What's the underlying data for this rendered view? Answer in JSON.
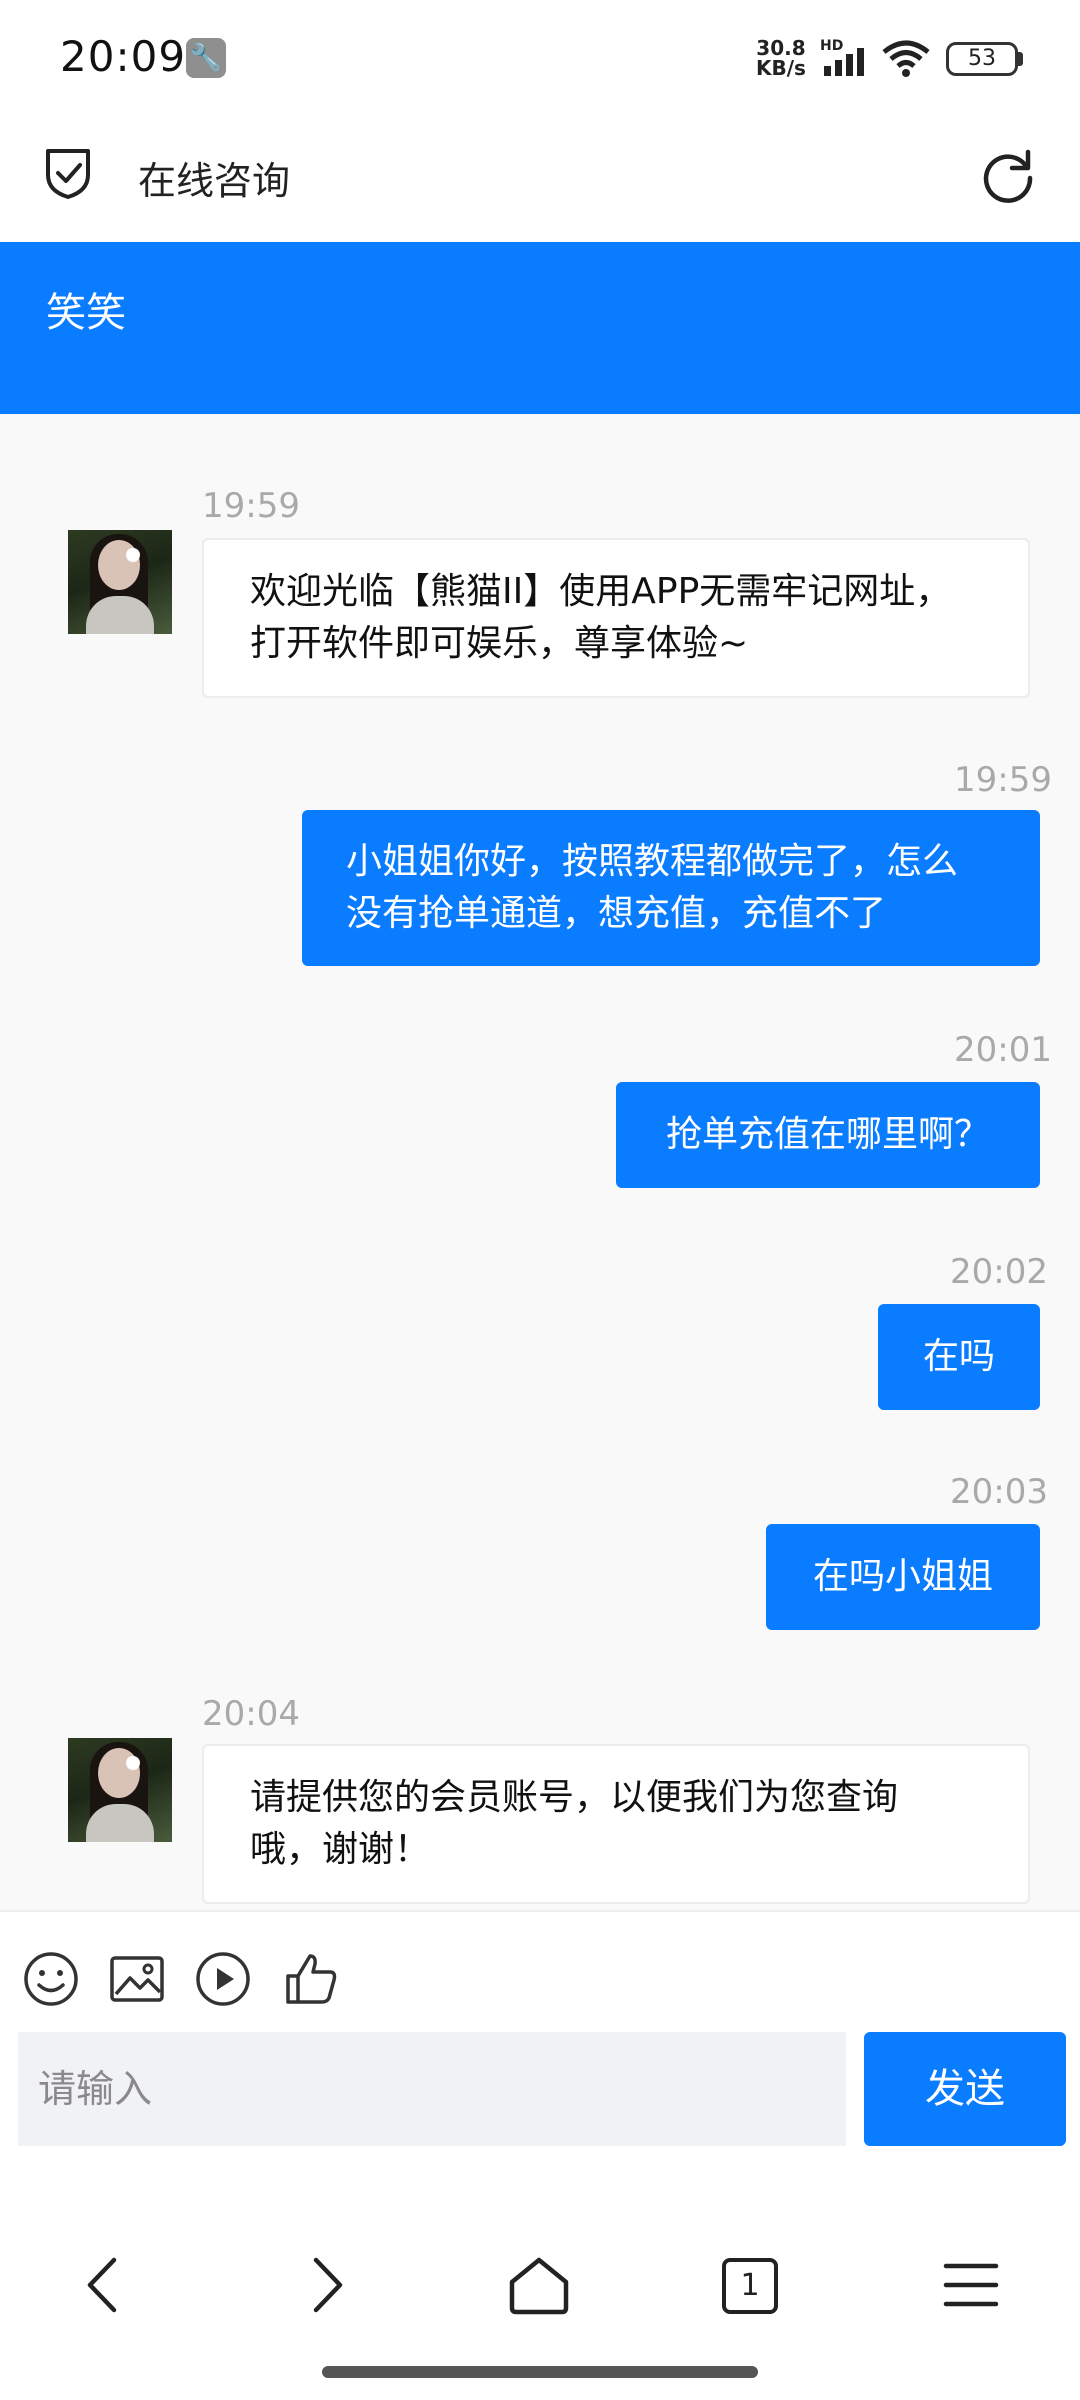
{
  "status_bar": {
    "time": "20:09",
    "net_speed_value": "30.8",
    "net_speed_unit": "KB/s",
    "hd_label": "HD",
    "battery": "53"
  },
  "toolbar": {
    "title": "在线咨询"
  },
  "agent": {
    "name": "笑笑"
  },
  "messages": [
    {
      "from": "agent",
      "time": "19:59",
      "lines": [
        "欢迎光临【熊猫II】使用APP无需牢记网址，",
        "打开软件即可娱乐，尊享体验~"
      ]
    },
    {
      "from": "user",
      "time": "19:59",
      "lines": [
        "小姐姐你好，按照教程都做完了，怎么",
        "没有抢单通道，想充值，充值不了"
      ]
    },
    {
      "from": "user",
      "time": "20:01",
      "lines": [
        "抢单充值在哪里啊？"
      ]
    },
    {
      "from": "user",
      "time": "20:02",
      "lines": [
        "在吗"
      ]
    },
    {
      "from": "user",
      "time": "20:03",
      "lines": [
        "在吗小姐姐"
      ]
    },
    {
      "from": "agent",
      "time": "20:04",
      "lines": [
        "请提供您的会员账号，以便我们为您查询",
        "哦，谢谢！"
      ]
    }
  ],
  "input": {
    "placeholder": "请输入",
    "send_label": "发送"
  },
  "bottom_nav": {
    "tab_count": "1"
  },
  "colors": {
    "accent": "#0a7cff",
    "chat_bg": "#f9f9f9",
    "timestamp": "#a9a9a9"
  }
}
